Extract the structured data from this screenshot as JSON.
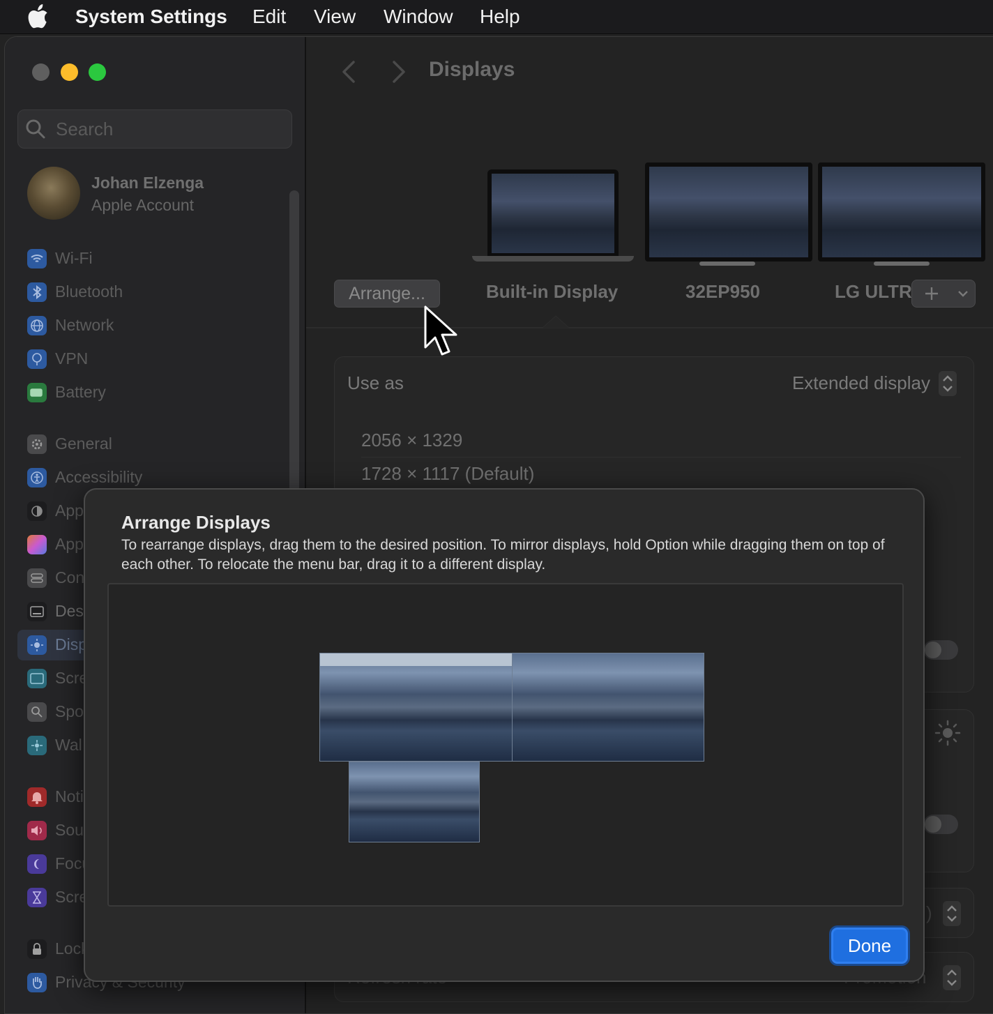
{
  "menubar": {
    "app_name": "System Settings",
    "items": [
      "Edit",
      "View",
      "Window",
      "Help"
    ]
  },
  "sidebar": {
    "search_placeholder": "Search",
    "account": {
      "name": "Johan Elzenga",
      "subtitle": "Apple Account"
    },
    "items": [
      {
        "label": "Wi-Fi",
        "icon": "wifi-icon",
        "color": "#3a7de0"
      },
      {
        "label": "Bluetooth",
        "icon": "bluetooth-icon",
        "color": "#3a7de0"
      },
      {
        "label": "Network",
        "icon": "globe-icon",
        "color": "#3a7de0"
      },
      {
        "label": "VPN",
        "icon": "vpn-icon",
        "color": "#3a7de0"
      },
      {
        "label": "Battery",
        "icon": "battery-icon",
        "color": "#34c759"
      },
      {
        "label": "General",
        "icon": "gear-icon",
        "color": "#8e8e93"
      },
      {
        "label": "Accessibility",
        "icon": "accessibility-icon",
        "color": "#3a7de0"
      },
      {
        "label": "App",
        "icon": "appearance-icon",
        "color": "#1c1c1e"
      },
      {
        "label": "App",
        "icon": "apple-intelligence-icon",
        "color": "#c85ad0"
      },
      {
        "label": "Con",
        "icon": "control-center-icon",
        "color": "#8e8e93"
      },
      {
        "label": "Des",
        "icon": "desktop-dock-icon",
        "color": "#1c1c1e"
      },
      {
        "label": "Disp",
        "icon": "displays-icon",
        "color": "#3a7de0"
      },
      {
        "label": "Scre",
        "icon": "screen-saver-icon",
        "color": "#34aadc"
      },
      {
        "label": "Spo",
        "icon": "spotlight-icon",
        "color": "#8e8e93"
      },
      {
        "label": "Wal",
        "icon": "wallpaper-icon",
        "color": "#34aadc"
      },
      {
        "label": "Noti",
        "icon": "notifications-icon",
        "color": "#ff3b30"
      },
      {
        "label": "Sou",
        "icon": "sound-icon",
        "color": "#ff2d55"
      },
      {
        "label": "Focu",
        "icon": "focus-icon",
        "color": "#5856d6"
      },
      {
        "label": "Scre",
        "icon": "screen-time-icon",
        "color": "#5856d6"
      },
      {
        "label": "Lock",
        "icon": "lock-icon",
        "color": "#1c1c1e"
      },
      {
        "label": "Privacy & Security",
        "icon": "privacy-hand-icon",
        "color": "#3a7de0"
      }
    ]
  },
  "main": {
    "title": "Displays",
    "arrange_button": "Arrange...",
    "displays": [
      {
        "label": "Built-in Display"
      },
      {
        "label": "32EP950"
      },
      {
        "label": "LG ULTR"
      }
    ],
    "use_as_label": "Use as",
    "use_as_value": "Extended display",
    "resolutions": [
      "2056 × 1329",
      "1728 × 1117 (Default)"
    ],
    "behind_texts": {
      "refresh_fragment": ")",
      "promotion_fragment": "ProMotion",
      "refresh_label": "Refresh rate"
    }
  },
  "dialog": {
    "title": "Arrange Displays",
    "description": "To rearrange displays, drag them to the desired position. To mirror displays, hold Option while dragging them on top of each other. To relocate the menu bar, drag it to a different display.",
    "done_label": "Done"
  },
  "colors": {
    "accent": "#1f6fe0",
    "traffic_close": "#5f5f5f",
    "traffic_min": "#fdbd2b",
    "traffic_max": "#2bc83f"
  }
}
